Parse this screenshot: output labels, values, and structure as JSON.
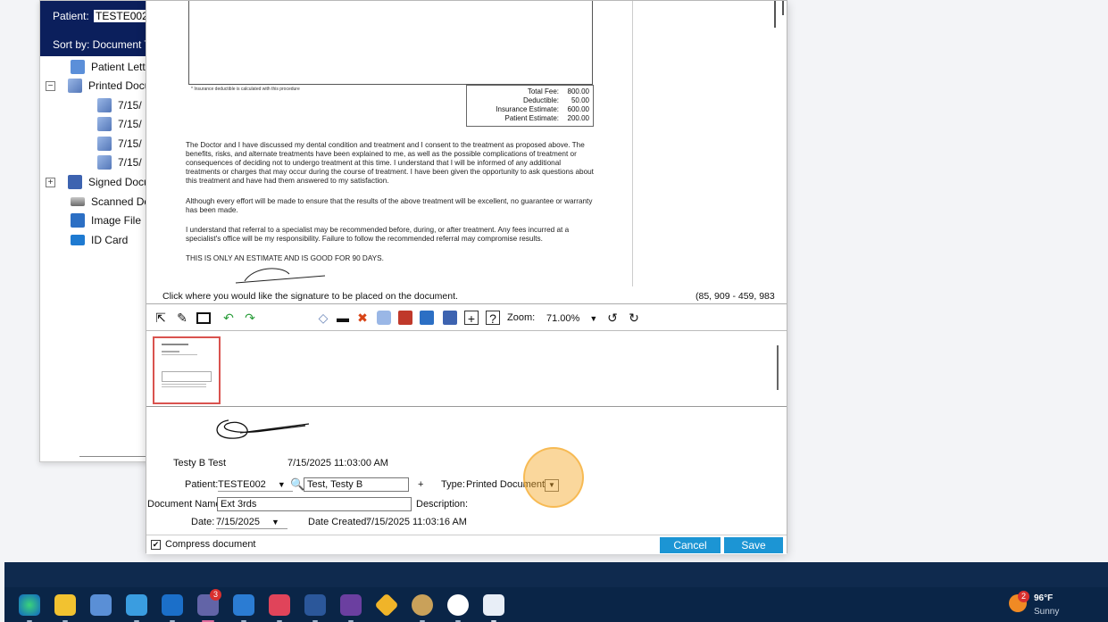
{
  "sidebar": {
    "patient_label": "Patient:",
    "patient_value": "TESTE002",
    "sort_label": "Sort by: Document T",
    "items": [
      {
        "label": "Patient Lette",
        "icon": "letter-doc-icon"
      },
      {
        "label": "Printed Docu",
        "icon": "printed-doc-icon",
        "expander": "−"
      },
      {
        "label": "7/15/",
        "icon": "printed-doc-icon"
      },
      {
        "label": "7/15/",
        "icon": "printed-doc-icon"
      },
      {
        "label": "7/15/",
        "icon": "printed-doc-icon"
      },
      {
        "label": "7/15/",
        "icon": "printed-doc-icon"
      },
      {
        "label": "Signed Docu",
        "icon": "signed-doc-icon",
        "expander": "+"
      },
      {
        "label": "Scanned Do",
        "icon": "scanned-doc-icon"
      },
      {
        "label": "Image File",
        "icon": "image-file-icon"
      },
      {
        "label": "ID Card",
        "icon": "id-card-icon"
      }
    ]
  },
  "document": {
    "note": "* Insurance deductible is calculated with this procedure",
    "costs": [
      {
        "label": "Total Fee:",
        "value": "800.00"
      },
      {
        "label": "Deductible:",
        "value": "50.00"
      },
      {
        "label": "Insurance Estimate:",
        "value": "600.00"
      },
      {
        "label": "Patient Estimate:",
        "value": "200.00"
      }
    ],
    "paragraphs": [
      "The Doctor and I have discussed my dental condition and treatment and I consent to the treatment as proposed above. The benefits, risks, and alternate treatments have been explained to me, as well as the possible complications of treatment or consequences of deciding not to undergo treatment at this time. I understand that I will be informed of any additional treatments or charges that may occur during the course of treatment. I have been given the opportunity to ask questions about this treatment and have had them answered to my satisfaction.",
      "Although every effort will be made to ensure that the results of the above treatment will be excellent, no guarantee or warranty has been made.",
      "I understand that referral to a specialist may be recommended before, during, or after treatment. Any fees incurred at a specialist's office will be my responsibility. Failure to follow the recommended referral may compromise results.",
      "THIS IS ONLY AN ESTIMATE AND IS GOOD FOR 90 DAYS."
    ]
  },
  "viewer": {
    "instruction": "Click where you would like the signature to be placed on the document.",
    "coords": "(85, 909 - 459, 983"
  },
  "toolbar": {
    "zoom_label": "Zoom:",
    "zoom_value": "71.00%"
  },
  "form": {
    "signer_name": "Testy B Test",
    "signed_time": "7/15/2025 11:03:00 AM",
    "patient_label": "Patient:",
    "patient_id": "TESTE002",
    "patient_name": "Test, Testy B",
    "plus": "+",
    "type_label": "Type:",
    "type_value": "Printed Document",
    "doc_name_label": "Document Name:",
    "doc_name_value": "Ext 3rds",
    "description_label": "Description:",
    "date_label": "Date:",
    "date_value": "7/15/2025",
    "date_created_label": "Date Created:",
    "date_created_value": "7/15/2025 11:03:16 AM",
    "compress_label": "Compress document",
    "compress_checked": true,
    "cancel_label": "Cancel",
    "save_label": "Save"
  },
  "colors": {
    "accent_button": "#1c95d4",
    "nav_bar": "#0b1f5c",
    "highlight": "#f5a623",
    "taskbar": "#0a2547"
  },
  "taskbar": {
    "apps": [
      "edge-icon",
      "file-explorer-icon",
      "store-icon",
      "outlook-new-icon",
      "outlook-icon",
      "teams-icon",
      "app-grid-icon",
      "flashcard-app-icon",
      "word-icon",
      "power-automate-icon",
      "diamond-app-icon",
      "chicken-app-icon",
      "dentrix-icon",
      "document-app-icon"
    ],
    "teams_badge": "3",
    "weather_badge": "2",
    "temperature": "96°F",
    "condition": "Sunny"
  }
}
